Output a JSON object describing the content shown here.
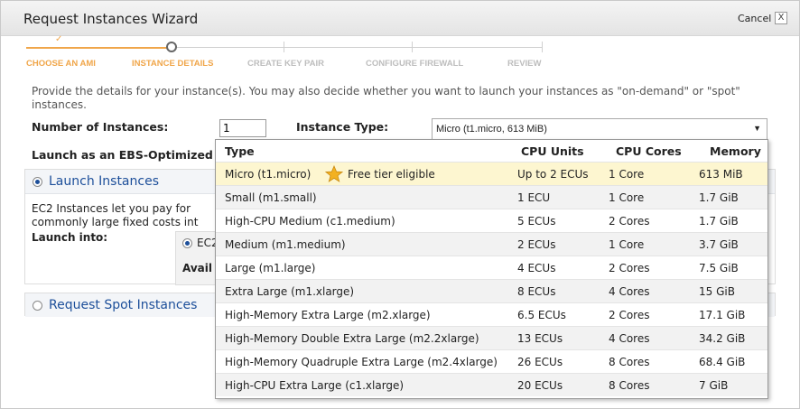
{
  "dialog": {
    "title": "Request Instances Wizard",
    "cancel_label": "Cancel",
    "close_glyph": "X"
  },
  "steps": [
    {
      "label": "CHOOSE AN AMI",
      "state": "done",
      "marker": "✓"
    },
    {
      "label": "INSTANCE DETAILS",
      "state": "active"
    },
    {
      "label": "CREATE KEY PAIR",
      "state": "pending"
    },
    {
      "label": "CONFIGURE FIREWALL",
      "state": "pending"
    },
    {
      "label": "REVIEW",
      "state": "pending"
    }
  ],
  "form": {
    "description": "Provide the details for your instance(s). You may also decide whether you want to launch your instances as \"on-demand\" or \"spot\" instances.",
    "num_instances_label": "Number of Instances:",
    "num_instances_value": "1",
    "instance_type_label": "Instance Type:",
    "instance_type_selected": "Micro (t1.micro, 613 MiB)",
    "ebs_label": "Launch as an EBS-Optimized in"
  },
  "launch_panel": {
    "title": "Launch Instances",
    "text_line1": "EC2 Instances let you pay for",
    "text_line2": "commonly large fixed costs int",
    "launch_into_label": "Launch into:",
    "option_fragment": "EC2",
    "avail_fragment": "Avail"
  },
  "spot_panel": {
    "title": "Request Spot Instances"
  },
  "dropdown": {
    "headers": {
      "type": "Type",
      "cpu_units": "CPU Units",
      "cpu_cores": "CPU Cores",
      "memory": "Memory"
    },
    "rows": [
      {
        "type": "Micro (t1.micro)",
        "badge": "Free tier eligible",
        "cpu_units": "Up to 2 ECUs",
        "cpu_cores": "1 Core",
        "memory": "613 MiB",
        "selected": true
      },
      {
        "type": "Small (m1.small)",
        "cpu_units": "1 ECU",
        "cpu_cores": "1 Core",
        "memory": "1.7 GiB"
      },
      {
        "type": "High-CPU Medium (c1.medium)",
        "cpu_units": "5 ECUs",
        "cpu_cores": "2 Cores",
        "memory": "1.7 GiB"
      },
      {
        "type": "Medium (m1.medium)",
        "cpu_units": "2 ECUs",
        "cpu_cores": "1 Core",
        "memory": "3.7 GiB"
      },
      {
        "type": "Large (m1.large)",
        "cpu_units": "4 ECUs",
        "cpu_cores": "2 Cores",
        "memory": "7.5 GiB"
      },
      {
        "type": "Extra Large (m1.xlarge)",
        "cpu_units": "8 ECUs",
        "cpu_cores": "4 Cores",
        "memory": "15 GiB"
      },
      {
        "type": "High-Memory Extra Large (m2.xlarge)",
        "cpu_units": "6.5 ECUs",
        "cpu_cores": "2 Cores",
        "memory": "17.1 GiB"
      },
      {
        "type": "High-Memory Double Extra Large (m2.2xlarge)",
        "cpu_units": "13 ECUs",
        "cpu_cores": "4 Cores",
        "memory": "34.2 GiB"
      },
      {
        "type": "High-Memory Quadruple Extra Large (m2.4xlarge)",
        "cpu_units": "26 ECUs",
        "cpu_cores": "8 Cores",
        "memory": "68.4 GiB"
      },
      {
        "type": "High-CPU Extra Large (c1.xlarge)",
        "cpu_units": "20 ECUs",
        "cpu_cores": "8 Cores",
        "memory": "7 GiB"
      }
    ]
  },
  "colors": {
    "accent": "#f0a64a",
    "link": "#1d4f9a",
    "selected_row": "#fdf6d0"
  },
  "icons": {
    "free_tier": "star-icon",
    "dropdown": "chevron-down-icon"
  }
}
